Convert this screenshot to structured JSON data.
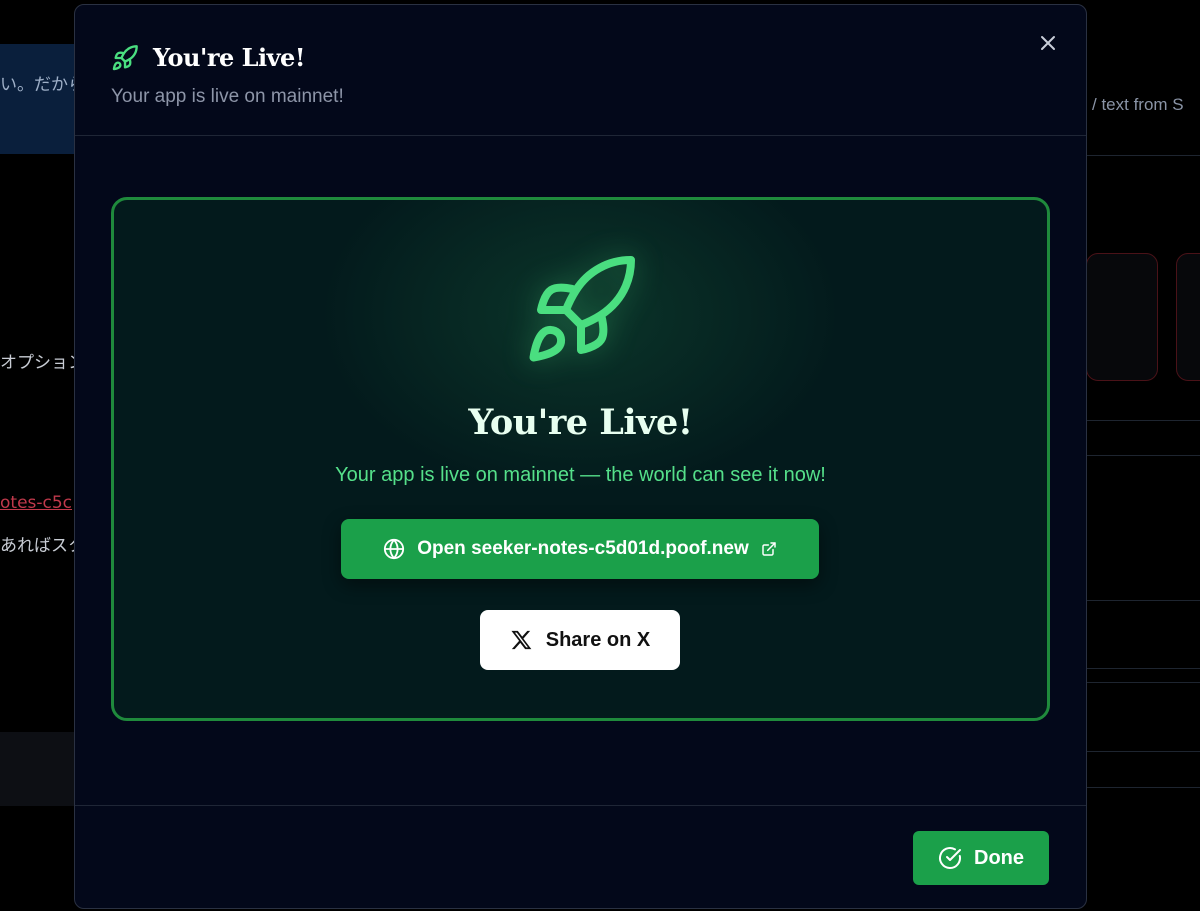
{
  "background": {
    "jp_line_1": "い。だから",
    "jp_line_2": "オプション",
    "jp_line_3": "otes-c5c",
    "jp_line_4": "あればスク",
    "right_text": "/ text from S"
  },
  "modal": {
    "title": "You're Live!",
    "subtitle": "Your app is live on mainnet!",
    "title_icon": "rocket-icon",
    "close_icon": "close-icon"
  },
  "card": {
    "title": "You're Live!",
    "subtitle": "Your app is live on mainnet — the world can see it now!",
    "open_button_label": "Open seeker-notes-c5d01d.poof.new",
    "share_button_label": "Share on X"
  },
  "footer": {
    "done_label": "Done"
  },
  "colors": {
    "accent_green": "#1ba04a",
    "card_border": "#1f8a3c",
    "rocket_green": "#4ade80",
    "modal_bg": "#03081a"
  }
}
